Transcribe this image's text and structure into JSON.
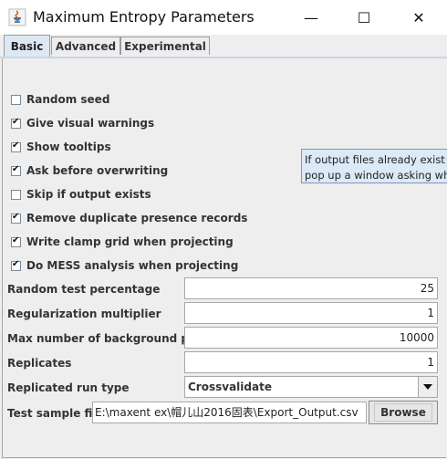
{
  "window": {
    "title": "Maximum Entropy Parameters",
    "minimize_glyph": "—",
    "maximize_glyph": "☐",
    "close_glyph": "✕"
  },
  "tabs": [
    {
      "label": "Basic",
      "active": true
    },
    {
      "label": "Advanced",
      "active": false
    },
    {
      "label": "Experimental",
      "active": false
    }
  ],
  "checkboxes": [
    {
      "label": "Random seed",
      "checked": false
    },
    {
      "label": "Give visual warnings",
      "checked": true
    },
    {
      "label": "Show tooltips",
      "checked": true
    },
    {
      "label": "Ask before overwriting",
      "checked": true
    },
    {
      "label": "Skip if output exists",
      "checked": false
    },
    {
      "label": "Remove duplicate presence records",
      "checked": true
    },
    {
      "label": "Write clamp grid when projecting",
      "checked": true
    },
    {
      "label": "Do MESS analysis when projecting",
      "checked": true
    }
  ],
  "tooltip": {
    "line1": "If output files already exist for",
    "line2": "pop up a window asking whe"
  },
  "fields": {
    "random_test_percentage": {
      "label": "Random test percentage",
      "value": "25"
    },
    "regularization_multiplier": {
      "label": "Regularization multiplier",
      "value": "1"
    },
    "max_background_points": {
      "label": "Max number of background points",
      "value": "10000"
    },
    "replicates": {
      "label": "Replicates",
      "value": "1"
    },
    "replicated_run_type": {
      "label": "Replicated run type",
      "value": "Crossvalidate"
    },
    "test_sample_file": {
      "label": "Test sample file",
      "value": "E:\\maxent ex\\帽儿山2016固表\\Export_Output.csv"
    }
  },
  "buttons": {
    "browse": "Browse"
  },
  "colors": {
    "active_tab": "#dde8f3",
    "tooltip_bg": "#dce9f7",
    "panel_bg": "#eeeeee"
  }
}
